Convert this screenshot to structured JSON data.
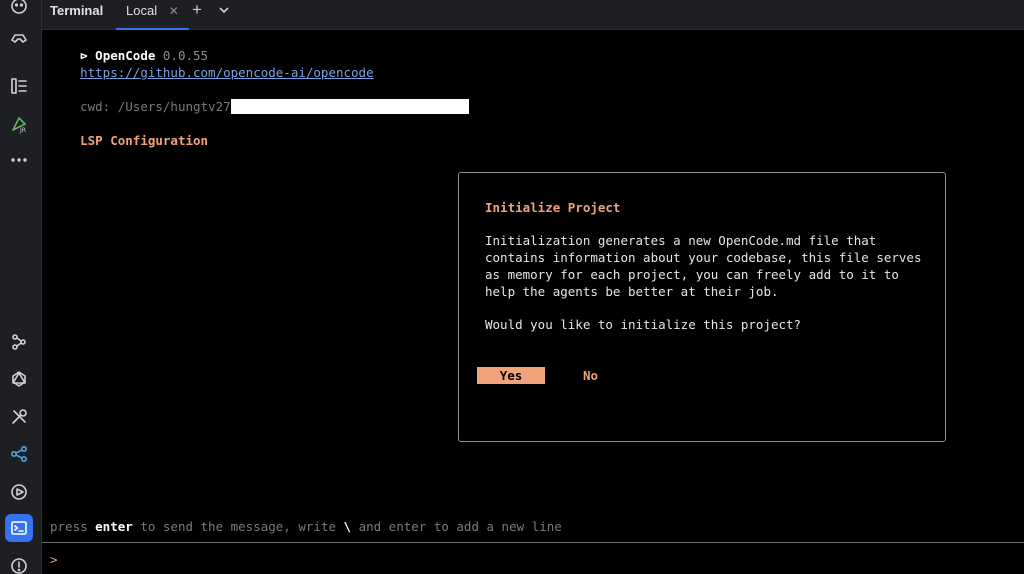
{
  "tabbar": {
    "title": "Terminal",
    "tab_label": "Local",
    "close_glyph": "✕",
    "add_glyph": "+"
  },
  "toolstrip": {
    "icons": [
      "plugin-icon",
      "game-controller-icon",
      "structure-icon",
      "jrebel-icon",
      "more-icon",
      "services-graph-icon",
      "graphql-icon",
      "build-tools-icon",
      "share-icon",
      "run-icon",
      "terminal-icon",
      "problems-icon"
    ],
    "active": "terminal-icon",
    "accent": "#3574f0"
  },
  "terminal": {
    "prompt_glyph": "⊳",
    "app_name": "OpenCode",
    "version": "0.0.55",
    "repo_url": "https://github.com/opencode-ai/opencode",
    "cwd_label": "cwd: /Users/hungtv27",
    "lsp_label": "LSP Configuration",
    "hint_prefix": "press ",
    "hint_key1": "enter",
    "hint_middle": " to send the message, write ",
    "hint_key2": "\\",
    "hint_suffix": " and enter to add a new line",
    "input_prompt": ">"
  },
  "dialog": {
    "title": "Initialize Project",
    "body": "Initialization generates a new OpenCode.md file that\ncontains information about your codebase, this file serves\nas memory for each project, you can freely add to it to\nhelp the agents be better at their job.",
    "question": "Would you like to initialize this project?",
    "yes_label": "Yes",
    "no_label": "No",
    "accent": "#f0a37a"
  }
}
